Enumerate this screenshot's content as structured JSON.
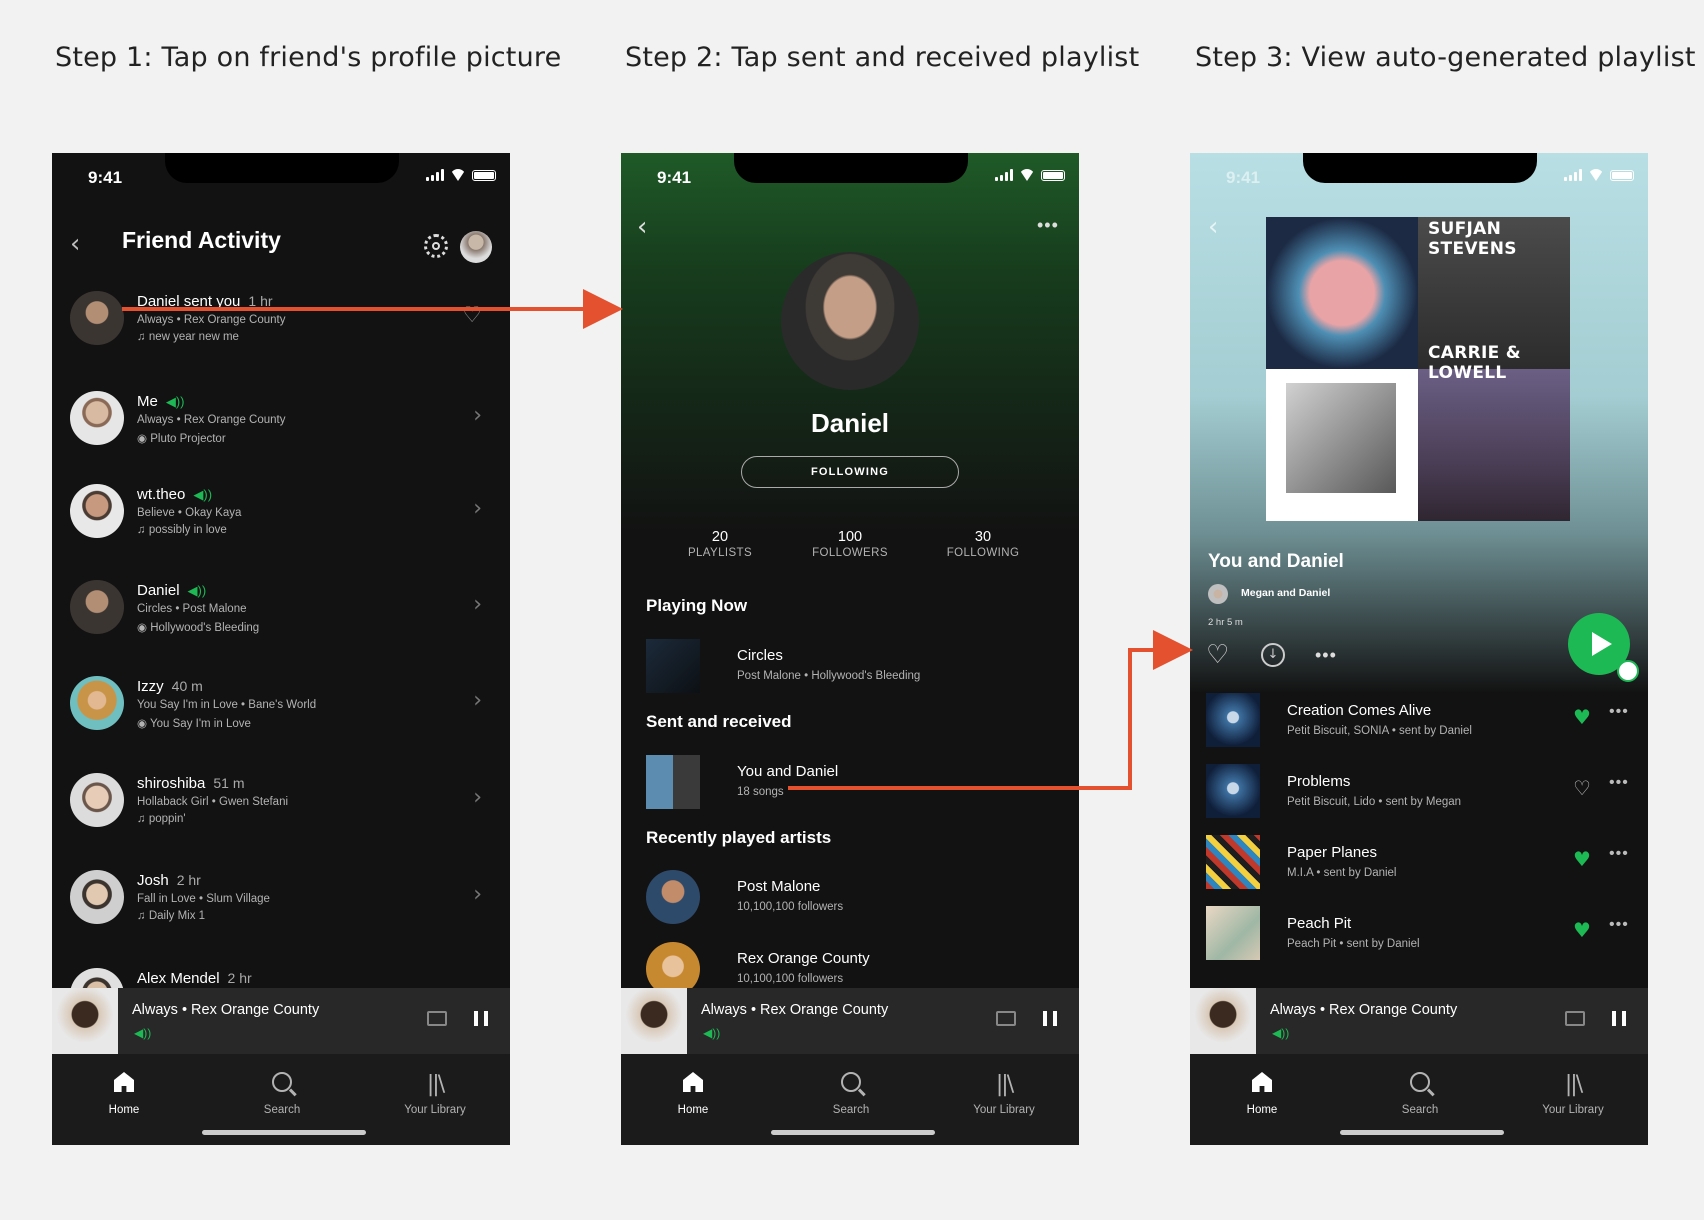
{
  "steps": [
    {
      "label": "Step 1: Tap on friend's profile picture"
    },
    {
      "label": "Step 2: Tap sent and received playlist"
    },
    {
      "label": "Step 3: View auto-generated playlist"
    }
  ],
  "status_time": "9:41",
  "colors": {
    "accent": "#1db954",
    "arrow": "#e4512f",
    "background": "#121212"
  },
  "screen1": {
    "header": "Friend Activity",
    "friends": [
      {
        "name": "Daniel sent you",
        "time": "1 hr",
        "track": "Always • Rex Orange County",
        "context": "new year new me",
        "context_icon": "music-note-icon",
        "action_icon": "heart-outline-icon"
      },
      {
        "name": "Me",
        "time": "",
        "live": true,
        "track": "Always • Rex Orange County",
        "context": "Pluto Projector",
        "context_icon": "album-icon",
        "action_icon": "chevron-right-icon"
      },
      {
        "name": "wt.theo",
        "time": "",
        "live": true,
        "track": "Believe • Okay Kaya",
        "context": "possibly in love",
        "context_icon": "music-note-icon",
        "action_icon": "chevron-right-icon"
      },
      {
        "name": "Daniel",
        "time": "",
        "live": true,
        "track": "Circles • Post Malone",
        "context": "Hollywood's Bleeding",
        "context_icon": "album-icon",
        "action_icon": "chevron-right-icon"
      },
      {
        "name": "Izzy",
        "time": "40 m",
        "track": "You Say I'm in Love • Bane's World",
        "context": "You Say I'm in Love",
        "context_icon": "album-icon",
        "action_icon": "chevron-right-icon"
      },
      {
        "name": "shiroshiba",
        "time": "51 m",
        "track": "Hollaback Girl • Gwen Stefani",
        "context": "poppin'",
        "context_icon": "music-note-icon",
        "action_icon": "chevron-right-icon"
      },
      {
        "name": "Josh",
        "time": "2 hr",
        "track": "Fall in Love • Slum Village",
        "context": "Daily Mix 1",
        "context_icon": "music-note-icon",
        "action_icon": "chevron-right-icon"
      },
      {
        "name": "Alex Mendel",
        "time": "2 hr",
        "track": "",
        "context": "",
        "context_icon": "",
        "action_icon": "chevron-right-icon"
      }
    ]
  },
  "screen2": {
    "name": "Daniel",
    "follow_label": "FOLLOWING",
    "stats": [
      {
        "value": "20",
        "label": "PLAYLISTS"
      },
      {
        "value": "100",
        "label": "FOLLOWERS"
      },
      {
        "value": "30",
        "label": "FOLLOWING"
      }
    ],
    "playing_now_title": "Playing Now",
    "playing_now": {
      "title": "Circles",
      "sub": "Post Malone • Hollywood's Bleeding"
    },
    "sent_received_title": "Sent and received",
    "sent_received": {
      "title": "You and Daniel",
      "sub": "18 songs"
    },
    "recent_artists_title": "Recently played artists",
    "artists": [
      {
        "name": "Post Malone",
        "followers": "10,100,100 followers"
      },
      {
        "name": "Rex Orange County",
        "followers": "10,100,100 followers"
      }
    ]
  },
  "screen3": {
    "cover_text_top": "SUFJAN STEVENS",
    "cover_text_bottom": "CARRIE & LOWELL",
    "title": "You and Daniel",
    "owners": "Megan and Daniel",
    "duration": "2 hr 5 m",
    "tracks": [
      {
        "title": "Creation Comes Alive",
        "sub": "Petit Biscuit, SONIA • sent by Daniel",
        "liked": true
      },
      {
        "title": "Problems",
        "sub": "Petit Biscuit, Lido • sent by Megan",
        "liked": false
      },
      {
        "title": "Paper Planes",
        "sub": "M.I.A • sent by Daniel",
        "liked": true
      },
      {
        "title": "Peach Pit",
        "sub": "Peach Pit • sent by Daniel",
        "liked": true
      }
    ]
  },
  "mini_player": {
    "title": "Always • Rex Orange County"
  },
  "nav": {
    "home": "Home",
    "search": "Search",
    "library": "Your Library"
  }
}
